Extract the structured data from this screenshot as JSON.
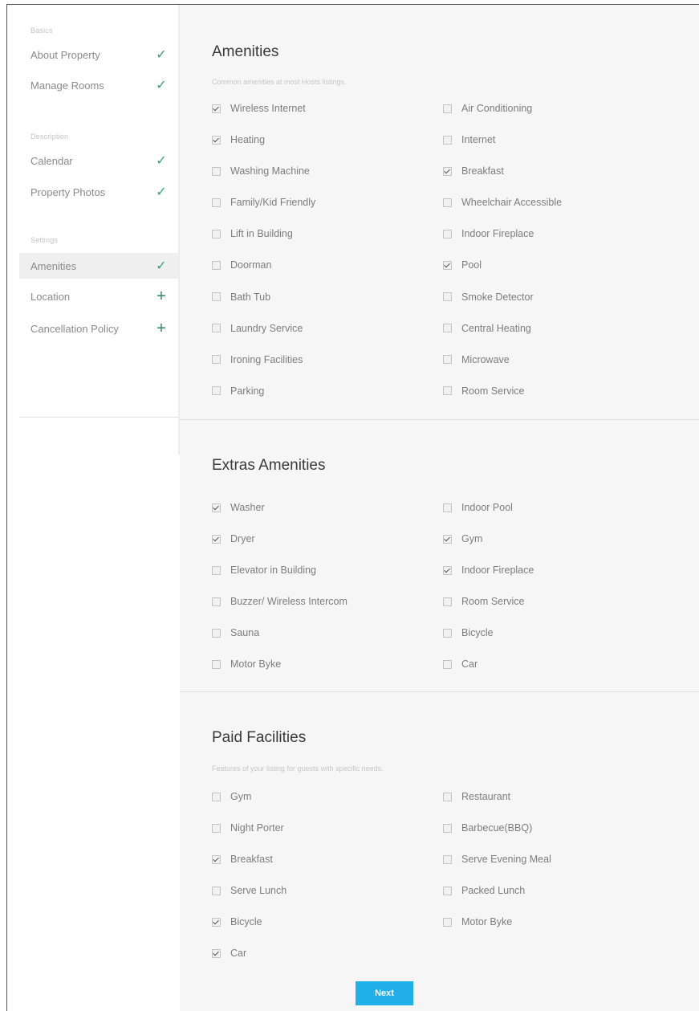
{
  "sidebar": {
    "groups": [
      {
        "title": "Basics",
        "items": [
          {
            "label": "About Property",
            "status": "check"
          },
          {
            "label": "Manage Rooms",
            "status": "check"
          }
        ]
      },
      {
        "title": "Description",
        "items": [
          {
            "label": "Calendar",
            "status": "check"
          },
          {
            "label": "Property Photos",
            "status": "check"
          }
        ]
      },
      {
        "title": "Settings",
        "items": [
          {
            "label": "Amenities",
            "status": "check",
            "active": true
          },
          {
            "label": "Location",
            "status": "plus"
          },
          {
            "label": "Cancellation Policy",
            "status": "plus"
          }
        ]
      }
    ],
    "status_glyphs": {
      "check": "✓",
      "plus": "+"
    },
    "colors": {
      "check": "#2fa56a",
      "active_bg": "#efefef"
    }
  },
  "sections": [
    {
      "title": "Amenities",
      "subtitle": "Common amenities at most Hosts listings.",
      "options": [
        {
          "label": "Wireless Internet",
          "checked": true
        },
        {
          "label": "Air Conditioning",
          "checked": false
        },
        {
          "label": "Heating",
          "checked": true
        },
        {
          "label": "Internet",
          "checked": false
        },
        {
          "label": "Washing Machine",
          "checked": false
        },
        {
          "label": "Breakfast",
          "checked": true
        },
        {
          "label": "Family/Kid Friendly",
          "checked": false
        },
        {
          "label": "Wheelchair Accessible",
          "checked": false
        },
        {
          "label": "Lift in Building",
          "checked": false
        },
        {
          "label": "Indoor Fireplace",
          "checked": false
        },
        {
          "label": "Doorman",
          "checked": false
        },
        {
          "label": "Pool",
          "checked": true
        },
        {
          "label": "Bath Tub",
          "checked": false
        },
        {
          "label": "Smoke Detector",
          "checked": false
        },
        {
          "label": "Laundry Service",
          "checked": false
        },
        {
          "label": "Central Heating",
          "checked": false
        },
        {
          "label": "Ironing Facilities",
          "checked": false
        },
        {
          "label": "Microwave",
          "checked": false
        },
        {
          "label": "Parking",
          "checked": false
        },
        {
          "label": "Room Service",
          "checked": false
        }
      ]
    },
    {
      "title": "Extras Amenities",
      "subtitle": "",
      "options": [
        {
          "label": "Washer",
          "checked": true
        },
        {
          "label": "Indoor Pool",
          "checked": false
        },
        {
          "label": "Dryer",
          "checked": true
        },
        {
          "label": "Gym",
          "checked": true
        },
        {
          "label": "Elevator in Building",
          "checked": false
        },
        {
          "label": "Indoor Fireplace",
          "checked": true
        },
        {
          "label": "Buzzer/ Wireless Intercom",
          "checked": false
        },
        {
          "label": "Room Service",
          "checked": false
        },
        {
          "label": "Sauna",
          "checked": false
        },
        {
          "label": "Bicycle",
          "checked": false
        },
        {
          "label": "Motor Byke",
          "checked": false
        },
        {
          "label": "Car",
          "checked": false
        }
      ]
    },
    {
      "title": "Paid Facilities",
      "subtitle": "Features of your listing for guests with specific needs.",
      "options": [
        {
          "label": "Gym",
          "checked": false
        },
        {
          "label": "Restaurant",
          "checked": false
        },
        {
          "label": "Night Porter",
          "checked": false
        },
        {
          "label": "Barbecue(BBQ)",
          "checked": false
        },
        {
          "label": "Breakfast",
          "checked": true
        },
        {
          "label": "Serve Evening Meal",
          "checked": false
        },
        {
          "label": "Serve Lunch",
          "checked": false
        },
        {
          "label": "Packed Lunch",
          "checked": false
        },
        {
          "label": "Bicycle",
          "checked": true
        },
        {
          "label": "Motor Byke",
          "checked": false
        },
        {
          "label": "Car",
          "checked": true
        }
      ]
    }
  ],
  "footer": {
    "next_label": "Next"
  },
  "colors": {
    "accent": "#21b0ea",
    "main_bg": "#f6f6f6"
  }
}
